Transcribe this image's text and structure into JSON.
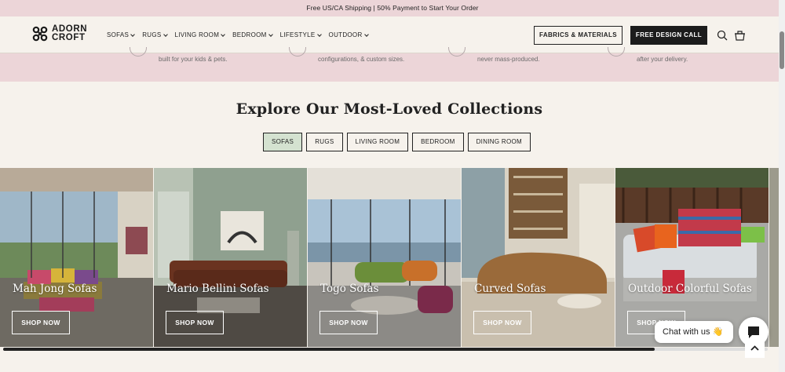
{
  "announcement": "Free US/CA Shipping | 50% Payment to Start Your Order",
  "logo": {
    "line1": "ADORN",
    "line2": "CROFT"
  },
  "nav": {
    "items": [
      {
        "label": "SOFAS"
      },
      {
        "label": "RUGS"
      },
      {
        "label": "LIVING ROOM"
      },
      {
        "label": "BEDROOM"
      },
      {
        "label": "LIFESTYLE"
      },
      {
        "label": "OUTDOOR"
      }
    ],
    "fabrics_button": "FABRICS & MATERIALS",
    "call_button": "FREE DESIGN CALL"
  },
  "features": [
    {
      "text": "built for your kids & pets."
    },
    {
      "text": "configurations, & custom sizes."
    },
    {
      "text": "never mass-produced."
    },
    {
      "text": "after your delivery."
    }
  ],
  "section_title": "Explore Our Most-Loved Collections",
  "tabs": [
    {
      "label": "SOFAS",
      "active": true
    },
    {
      "label": "RUGS",
      "active": false
    },
    {
      "label": "LIVING ROOM",
      "active": false
    },
    {
      "label": "BEDROOM",
      "active": false
    },
    {
      "label": "DINING ROOM",
      "active": false
    }
  ],
  "cards": [
    {
      "title": "Mah Jong Sofas",
      "button": "SHOP NOW"
    },
    {
      "title": "Mario Bellini Sofas",
      "button": "SHOP NOW"
    },
    {
      "title": "Togo Sofas",
      "button": "SHOP NOW"
    },
    {
      "title": "Curved Sofas",
      "button": "SHOP NOW"
    },
    {
      "title": "Outdoor Colorful Sofas",
      "button": "SHOP NOW"
    }
  ],
  "chat": {
    "label": "Chat with us 👋"
  },
  "colors": {
    "announce_bg": "#ecd5d8",
    "page_bg": "#f6f2ec",
    "active_tab": "#d4e2d0",
    "dark_button": "#1c1c1c"
  },
  "icons": [
    "logo-knot-icon",
    "chevron-down-icon",
    "search-icon",
    "cart-icon",
    "chat-bubble-icon",
    "chevron-up-icon"
  ]
}
